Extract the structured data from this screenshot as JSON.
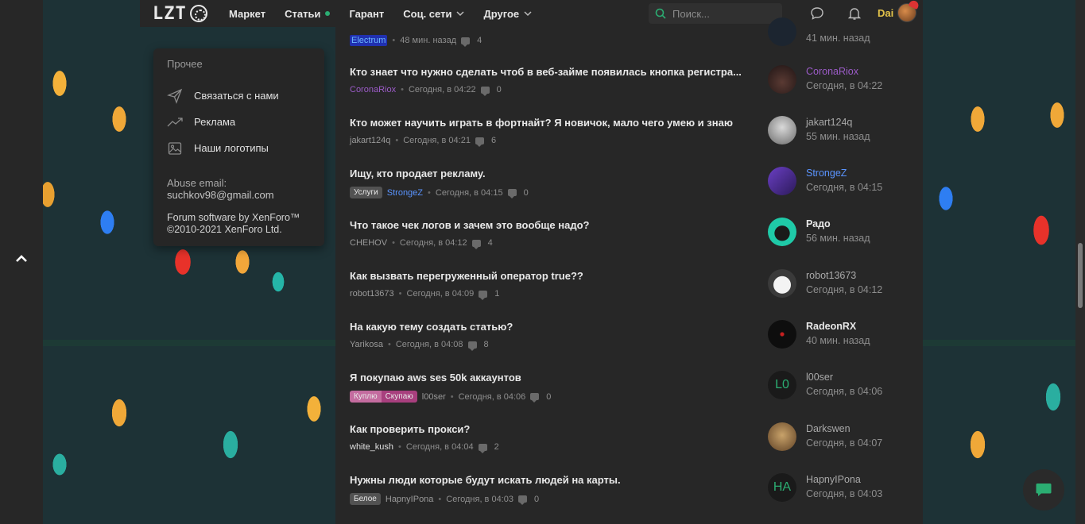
{
  "nav": {
    "logo_text": "LZT",
    "items": [
      {
        "label": "Маркет",
        "dot": false,
        "chevron": false
      },
      {
        "label": "Статьи",
        "dot": true,
        "chevron": false
      },
      {
        "label": "Гарант",
        "dot": false,
        "chevron": false
      },
      {
        "label": "Соц. сети",
        "dot": false,
        "chevron": true
      },
      {
        "label": "Другое",
        "dot": false,
        "chevron": true
      }
    ],
    "search_placeholder": "Поиск...",
    "user": "Dai",
    "accent": "#2bad72"
  },
  "dropdown": {
    "heading": "Прочее",
    "items": [
      {
        "label": "Связаться с нами",
        "icon": "send-icon"
      },
      {
        "label": "Реклама",
        "icon": "trend-icon"
      },
      {
        "label": "Наши логотипы",
        "icon": "image-icon"
      }
    ],
    "abuse_label": "Abuse email:",
    "abuse_email": "suchkov98@gmail.com",
    "software_line1": "Forum software by XenForo™",
    "software_line2": "©2010-2021 XenForo Ltd."
  },
  "threads": [
    {
      "title": "",
      "author": "Electrum",
      "author_style": "electrum",
      "time": "48 мин. назад",
      "replies": "4",
      "tags": []
    },
    {
      "title": "Кто знает что нужно сделать чтоб в веб-займе появилась кнопка регистра...",
      "author": "CoronaRiox",
      "author_style": "purple",
      "time": "Сегодня, в 04:22",
      "replies": "0",
      "tags": []
    },
    {
      "title": "Кто может научить играть в фортнайт? Я новичок, мало чего умею и знаю",
      "author": "jakart124q",
      "author_style": "",
      "time": "Сегодня, в 04:21",
      "replies": "6",
      "tags": []
    },
    {
      "title": "Ищу, кто продает рекламу.",
      "author": "StrongeZ",
      "author_style": "blue",
      "time": "Сегодня, в 04:15",
      "replies": "0",
      "tags": [
        "Услуги"
      ]
    },
    {
      "title": "Что такое чек логов и зачем это вообще надо?",
      "author": "CHEHOV",
      "author_style": "",
      "time": "Сегодня, в 04:12",
      "replies": "4",
      "tags": []
    },
    {
      "title": "Как вызвать перегруженный оператор true??",
      "author": "robot13673",
      "author_style": "",
      "time": "Сегодня, в 04:09",
      "replies": "1",
      "tags": []
    },
    {
      "title": "На какую тему создать статью?",
      "author": "Yarikosa",
      "author_style": "",
      "time": "Сегодня, в 04:08",
      "replies": "8",
      "tags": []
    },
    {
      "title": "Я покупаю aws ses 50k аккаунтов",
      "author": "l00ser",
      "author_style": "",
      "time": "Сегодня, в 04:06",
      "replies": "0",
      "tags": [
        "Куплю",
        "Скупаю"
      ]
    },
    {
      "title": "Как проверить прокси?",
      "author": "white_kush",
      "author_style": "white",
      "time": "Сегодня, в 04:04",
      "replies": "2",
      "tags": []
    },
    {
      "title": "Нужны люди которые будут искать людей на карты.",
      "author": "HapnyIPona",
      "author_style": "",
      "time": "Сегодня, в 04:03",
      "replies": "0",
      "tags": [
        "Белое"
      ]
    }
  ],
  "last_posts": [
    {
      "name": "",
      "time": "41 мин. назад",
      "style": ""
    },
    {
      "name": "CoronaRiox",
      "time": "Сегодня, в 04:22",
      "style": "purple"
    },
    {
      "name": "jakart124q",
      "time": "55 мин. назад",
      "style": ""
    },
    {
      "name": "StrongeZ",
      "time": "Сегодня, в 04:15",
      "style": "blue"
    },
    {
      "name": "Радо",
      "time": "56 мин. назад",
      "style": "bold"
    },
    {
      "name": "robot13673",
      "time": "Сегодня, в 04:12",
      "style": ""
    },
    {
      "name": "RadeonRX",
      "time": "40 мин. назад",
      "style": "bold"
    },
    {
      "name": "l00ser",
      "time": "Сегодня, в 04:06",
      "style": "",
      "avatar_letter": "L0"
    },
    {
      "name": "Darkswen",
      "time": "Сегодня, в 04:07",
      "style": ""
    },
    {
      "name": "HapnyIPona",
      "time": "Сегодня, в 04:03",
      "style": "",
      "avatar_letter": "HA"
    }
  ]
}
